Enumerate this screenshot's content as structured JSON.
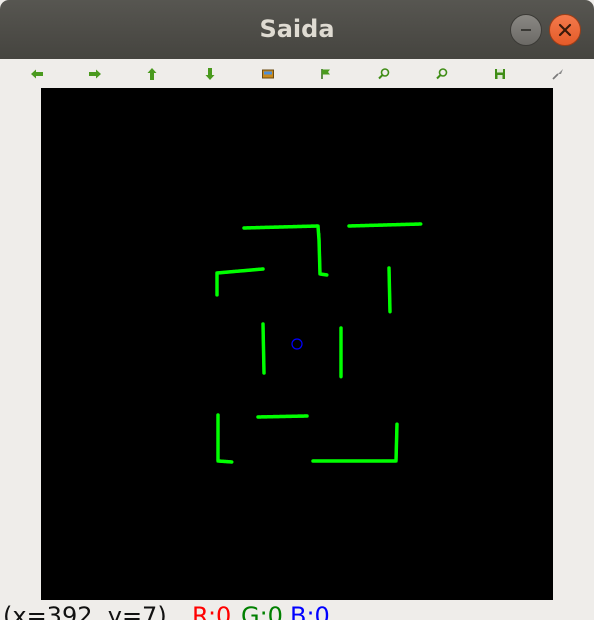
{
  "window": {
    "title": "Saida"
  },
  "toolbar": {
    "items": [
      {
        "icon": "arrow-left-icon"
      },
      {
        "icon": "arrow-right-icon"
      },
      {
        "icon": "arrow-up-icon"
      },
      {
        "icon": "arrow-down-icon"
      },
      {
        "icon": "image-icon"
      },
      {
        "icon": "grid-flag-icon"
      },
      {
        "icon": "zoom-in-icon"
      },
      {
        "icon": "zoom-out-icon"
      },
      {
        "icon": "save-icon"
      },
      {
        "icon": "properties-icon"
      }
    ],
    "icon_color": "#4a9a1e"
  },
  "canvas": {
    "background": "#000000",
    "wall_color": "#00ff00",
    "robot_color": "#0000ff"
  },
  "status": {
    "coords": "(x=392, y=7)",
    "r": "R:0",
    "g": "G:0",
    "b": "B:0",
    "r_color": "#ff0000",
    "g_color": "#008000",
    "b_color": "#0000ff"
  }
}
